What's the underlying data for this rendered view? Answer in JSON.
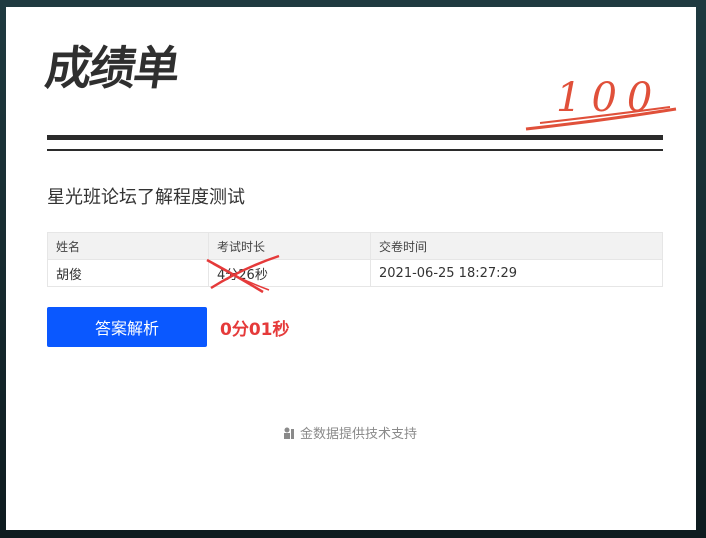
{
  "header": {
    "logo_text": "成绩单",
    "score_stamp": "100"
  },
  "exam": {
    "title": "星光班论坛了解程度测试"
  },
  "table": {
    "headers": [
      "姓名",
      "考试时长",
      "交卷时间"
    ],
    "row": {
      "name": "胡俊",
      "duration": "4分26秒",
      "submit_time": "2021-06-25 18:27:29"
    }
  },
  "actions": {
    "answer_button_label": "答案解析",
    "elapsed_time": "0分01秒"
  },
  "footer": {
    "text": "金数据提供技术支持",
    "icon": "jinshuju-logo-icon"
  },
  "colors": {
    "accent_blue": "#0a58ff",
    "stamp_red": "#e0503a",
    "elapsed_red": "#e53a3a"
  }
}
